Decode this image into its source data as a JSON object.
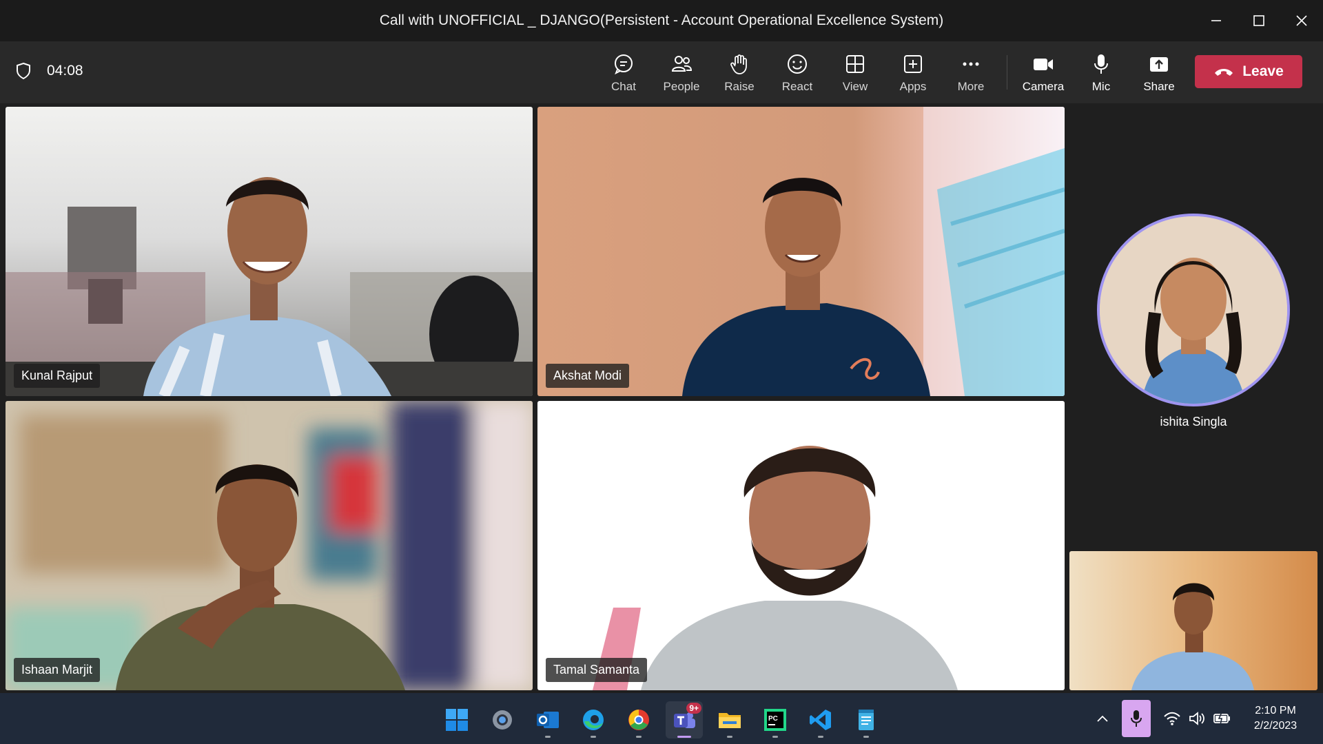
{
  "window": {
    "title": "Call with UNOFFICIAL _ DJANGO(Persistent - Account Operational Excellence System)"
  },
  "toolbar": {
    "timer": "04:08",
    "items": [
      {
        "label": "Chat",
        "icon": "chat-icon"
      },
      {
        "label": "People",
        "icon": "people-icon"
      },
      {
        "label": "Raise",
        "icon": "raise-hand-icon"
      },
      {
        "label": "React",
        "icon": "react-icon"
      },
      {
        "label": "View",
        "icon": "view-icon"
      },
      {
        "label": "Apps",
        "icon": "apps-icon"
      },
      {
        "label": "More",
        "icon": "more-icon"
      }
    ],
    "media": [
      {
        "label": "Camera",
        "icon": "camera-icon"
      },
      {
        "label": "Mic",
        "icon": "mic-icon"
      },
      {
        "label": "Share",
        "icon": "share-icon"
      }
    ],
    "leave_label": "Leave",
    "leave_color": "#c4314b"
  },
  "participants": {
    "p1": "Kunal Rajput",
    "p2": "Akshat Modi",
    "p3": "Ishaan Marjit",
    "p4": "Tamal Samanta",
    "avatar": "ishita Singla"
  },
  "taskbar": {
    "apps": [
      "windows-start-icon",
      "settings-icon",
      "outlook-icon",
      "edge-icon",
      "chrome-icon",
      "teams-icon",
      "file-explorer-icon",
      "pycharm-icon",
      "vscode-icon",
      "notepad-icon"
    ],
    "teams_badge": "9+",
    "time": "2:10 PM",
    "date": "2/2/2023"
  }
}
